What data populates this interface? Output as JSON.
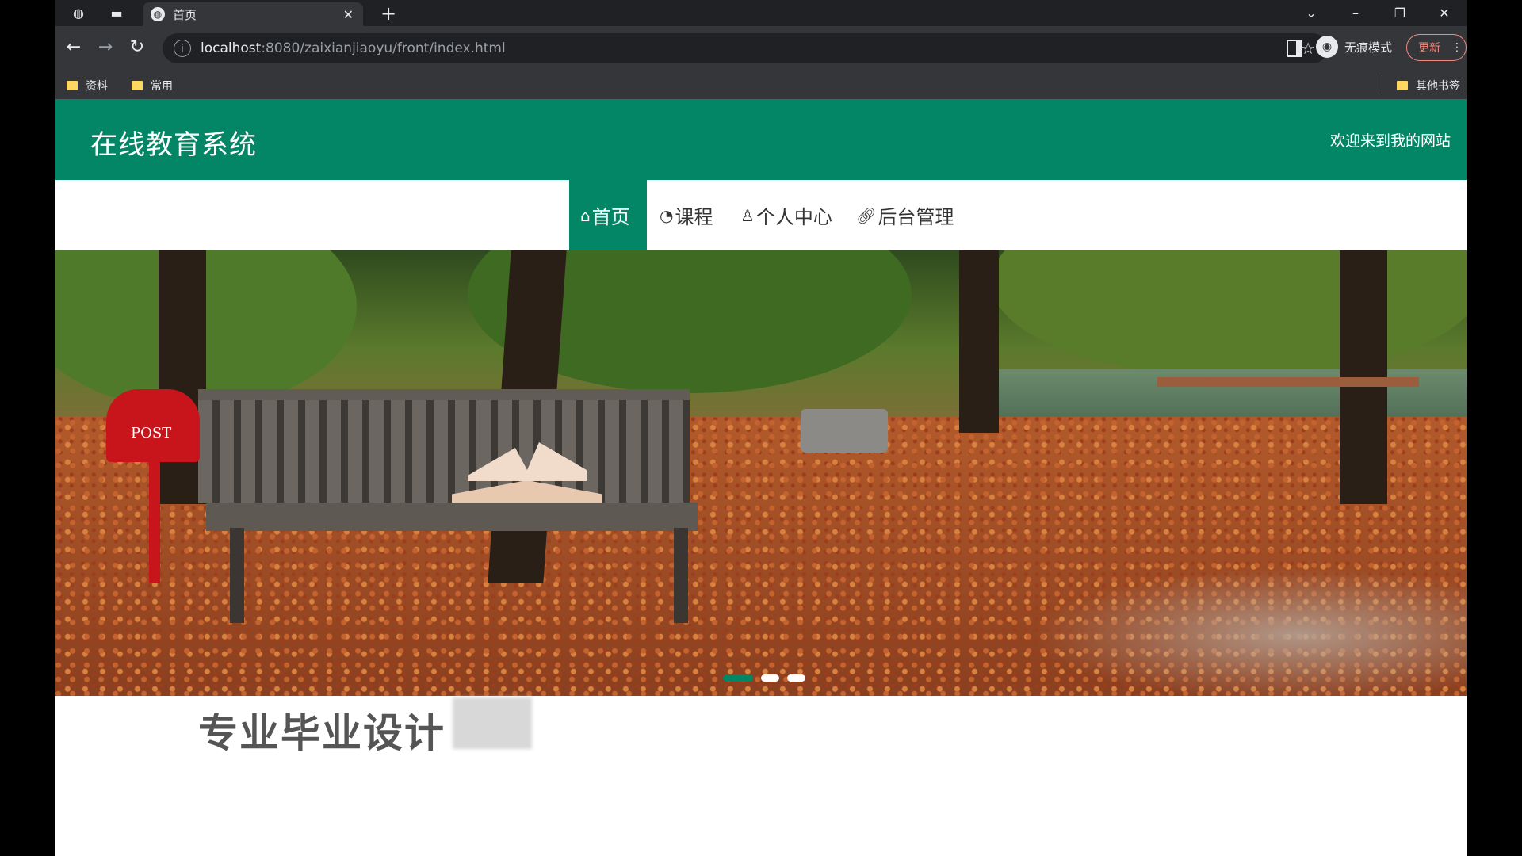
{
  "browser": {
    "tab_title": "首页",
    "url_host": "localhost",
    "url_path": ":8080/zaixianjiaoyu/front/index.html",
    "profile_label": "无痕模式",
    "update_label": "更新",
    "bookmarks": [
      "资料",
      "常用"
    ],
    "other_bookmarks": "其他书签"
  },
  "site": {
    "title": "在线教育系统",
    "welcome": "欢迎来到我的网站",
    "brand_color": "#038666",
    "nav": [
      {
        "label": "首页",
        "icon": "home-icon",
        "active": true
      },
      {
        "label": "课程",
        "icon": "course-icon",
        "active": false
      },
      {
        "label": "个人中心",
        "icon": "user-icon",
        "active": false
      },
      {
        "label": "后台管理",
        "icon": "link-icon",
        "active": false
      }
    ],
    "carousel": {
      "slides": 3,
      "active_index": 0
    },
    "section_title": "专业毕业设计"
  }
}
